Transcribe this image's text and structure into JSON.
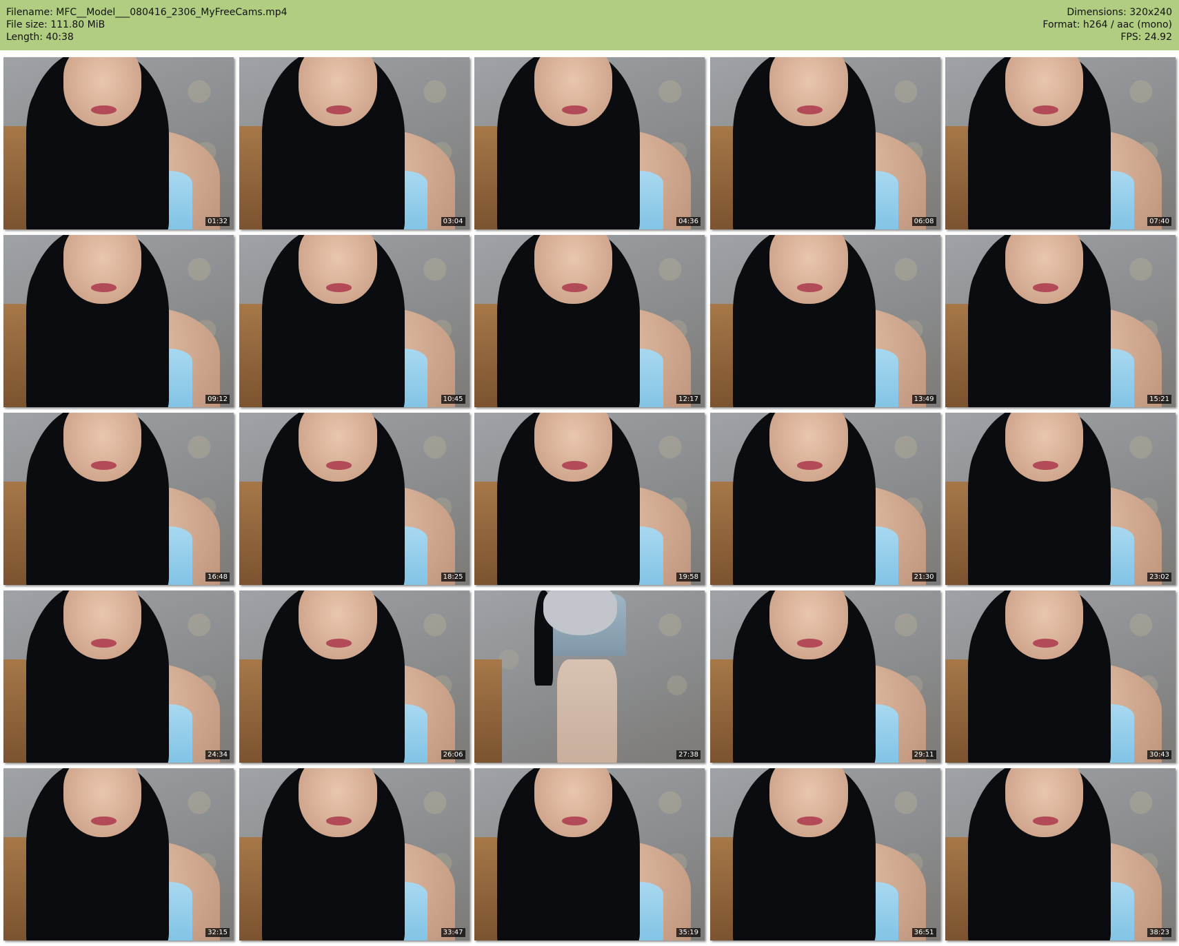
{
  "header": {
    "filename": "Filename: MFC__Model___080416_2306_MyFreeCams.mp4",
    "filesize": "File size: 111.80 MiB",
    "length": "Length: 40:38",
    "dimensions": "Dimensions: 320x240",
    "format": "Format: h264 / aac (mono)",
    "fps": "FPS: 24.92",
    "background_color": "#b1cd81"
  },
  "thumbnails": [
    {
      "timestamp": "01:32"
    },
    {
      "timestamp": "03:04"
    },
    {
      "timestamp": "04:36"
    },
    {
      "timestamp": "06:08"
    },
    {
      "timestamp": "07:40"
    },
    {
      "timestamp": "09:12"
    },
    {
      "timestamp": "10:45"
    },
    {
      "timestamp": "12:17"
    },
    {
      "timestamp": "13:49"
    },
    {
      "timestamp": "15:21"
    },
    {
      "timestamp": "16:48"
    },
    {
      "timestamp": "18:25"
    },
    {
      "timestamp": "19:58"
    },
    {
      "timestamp": "21:30"
    },
    {
      "timestamp": "23:02"
    },
    {
      "timestamp": "24:34"
    },
    {
      "timestamp": "26:06"
    },
    {
      "timestamp": "27:38"
    },
    {
      "timestamp": "29:11"
    },
    {
      "timestamp": "30:43"
    },
    {
      "timestamp": "32:15"
    },
    {
      "timestamp": "33:47"
    },
    {
      "timestamp": "35:19"
    },
    {
      "timestamp": "36:51"
    },
    {
      "timestamp": "38:23"
    }
  ]
}
